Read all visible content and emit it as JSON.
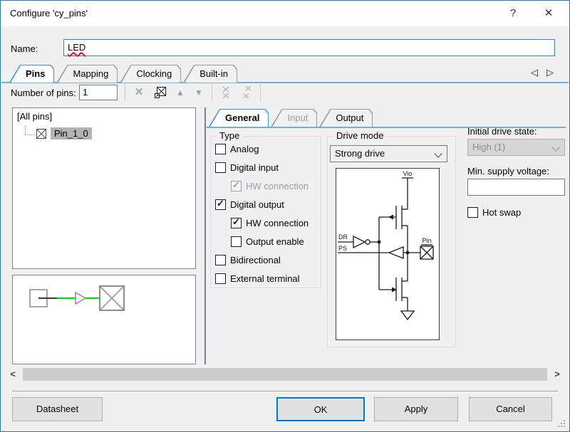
{
  "window": {
    "title": "Configure 'cy_pins'"
  },
  "icons": {
    "help": "?",
    "close": "✕",
    "tab_prev": "◁",
    "tab_next": "▷",
    "delete": "✕",
    "move_up": "▲",
    "move_down": "▼",
    "scroll_left": "<",
    "scroll_right": ">"
  },
  "name_field": {
    "label": "Name:",
    "value": "LED"
  },
  "tabs": [
    {
      "label": "Pins",
      "active": true
    },
    {
      "label": "Mapping",
      "active": false
    },
    {
      "label": "Clocking",
      "active": false
    },
    {
      "label": "Built-in",
      "active": false
    }
  ],
  "toolbar": {
    "pins_label": "Number of pins:",
    "pins_value": "1"
  },
  "tree": {
    "root": "[All pins]",
    "items": [
      {
        "label": "Pin_1_0",
        "selected": true
      }
    ]
  },
  "inner_tabs": [
    {
      "label": "General",
      "active": true,
      "enabled": true
    },
    {
      "label": "Input",
      "active": false,
      "enabled": false
    },
    {
      "label": "Output",
      "active": false,
      "enabled": true
    }
  ],
  "general": {
    "type": {
      "title": "Type",
      "items": [
        {
          "label": "Analog",
          "checked": false,
          "enabled": true,
          "indent": 0
        },
        {
          "label": "Digital input",
          "checked": false,
          "enabled": true,
          "indent": 0
        },
        {
          "label": "HW connection",
          "checked": true,
          "enabled": false,
          "indent": 1
        },
        {
          "label": "Digital output",
          "checked": true,
          "enabled": true,
          "indent": 0
        },
        {
          "label": "HW connection",
          "checked": true,
          "enabled": true,
          "indent": 1
        },
        {
          "label": "Output enable",
          "checked": false,
          "enabled": true,
          "indent": 1
        },
        {
          "label": "Bidirectional",
          "checked": false,
          "enabled": true,
          "indent": 0
        },
        {
          "label": "External terminal",
          "checked": false,
          "enabled": true,
          "indent": 0
        }
      ]
    },
    "drive_mode": {
      "title": "Drive mode",
      "value": "Strong drive"
    },
    "diagram": {
      "vio": "Vio",
      "dr": "DR",
      "ps": "PS",
      "pin": "Pin"
    },
    "initial_drive": {
      "label": "Initial drive state:",
      "value": "High (1)",
      "enabled": false
    },
    "min_supply": {
      "label": "Min. supply voltage:",
      "value": ""
    },
    "hot_swap": {
      "label": "Hot swap",
      "checked": false
    }
  },
  "footer": {
    "datasheet": "Datasheet",
    "ok": "OK",
    "apply": "Apply",
    "cancel": "Cancel"
  },
  "colors": {
    "accent_blue": "#2f82d6",
    "tab_blue": "#3f93dd",
    "underline_blue": "#6cb0e5",
    "ok_border": "#0078d7",
    "selection_gray": "#b3b3b3",
    "wire_green": "#00d800",
    "error_red": "#e01010"
  }
}
